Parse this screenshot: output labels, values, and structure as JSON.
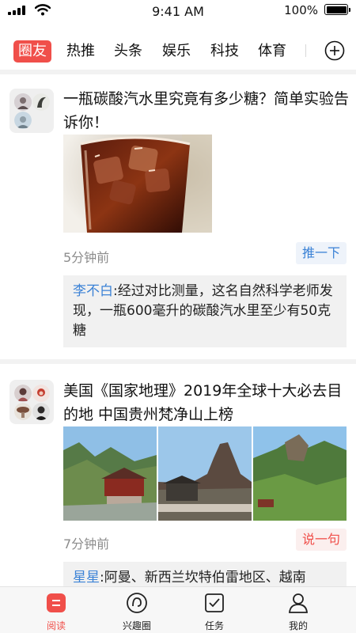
{
  "status_bar": {
    "time": "9:41 AM",
    "battery": "100%"
  },
  "tabs": [
    {
      "label": "圈友",
      "active": true
    },
    {
      "label": "热推"
    },
    {
      "label": "头条"
    },
    {
      "label": "娱乐"
    },
    {
      "label": "科技"
    },
    {
      "label": "体育"
    }
  ],
  "posts": [
    {
      "title": "一瓶碳酸汽水里究竟有多少糖？简单实验告诉你！",
      "time": "5分钟前",
      "action": "推一下",
      "comment": {
        "author": "李不白",
        "text": ":经过对比测量，这名自然科学老师发现，一瓶600毫升的碳酸汽水里至少有50克糖"
      }
    },
    {
      "title": " 美国《国家地理》2019年全球十大必去目的地 中国贵州梵净山上榜",
      "time": "7分钟前",
      "action": "说一句",
      "comment": {
        "author": "星星",
        "text": ":阿曼、新西兰坎特伯雷地区、越南"
      }
    }
  ],
  "bottom_nav": [
    {
      "label": "阅读",
      "icon": "read-icon",
      "active": true
    },
    {
      "label": "兴趣圈",
      "icon": "interest-circle-icon"
    },
    {
      "label": "任务",
      "icon": "task-icon"
    },
    {
      "label": "我的",
      "icon": "profile-icon"
    }
  ],
  "colors": {
    "accent": "#f04f4a",
    "link": "#3b82d6"
  }
}
